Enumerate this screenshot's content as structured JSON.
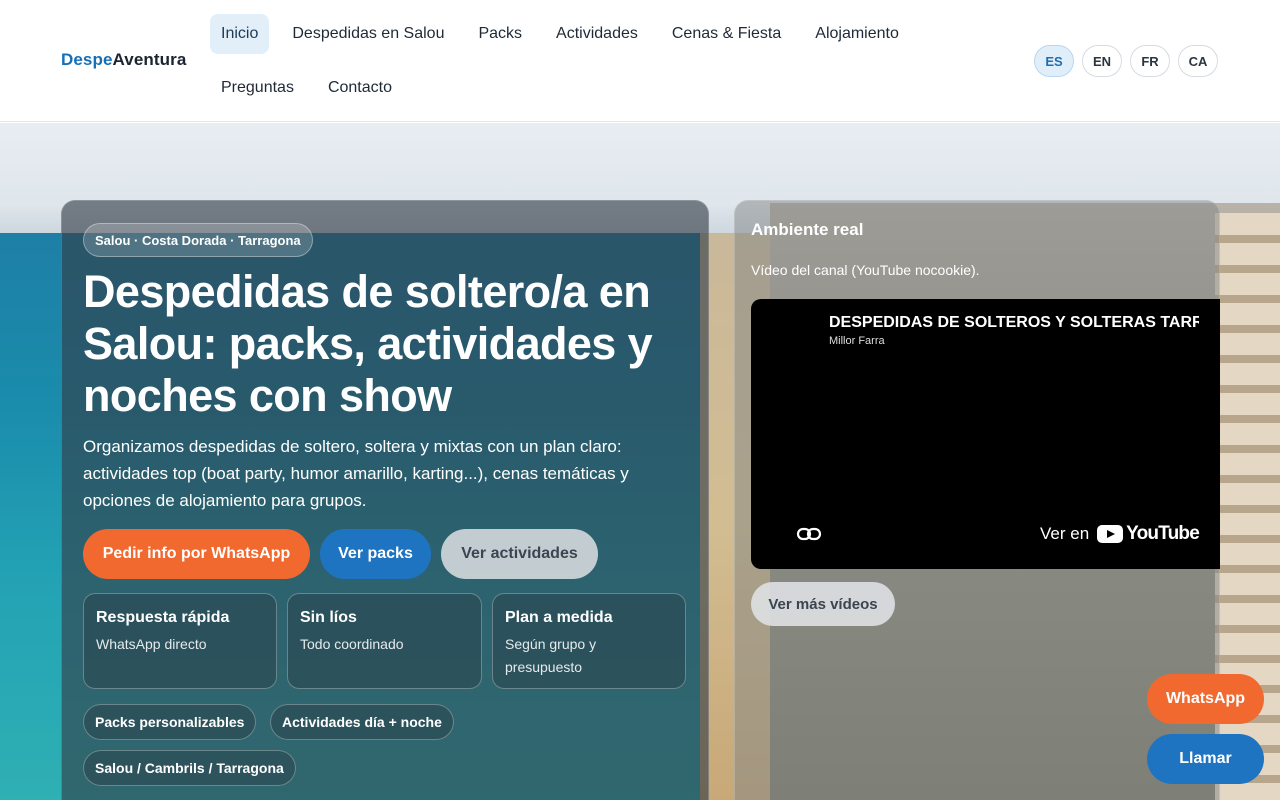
{
  "brand": {
    "part1": "Despe",
    "part2": "Aventura",
    "color_primary": "#1570b8"
  },
  "nav": {
    "row1": [
      "Inicio",
      "Despedidas en Salou",
      "Packs",
      "Actividades",
      "Cenas & Fiesta",
      "Alojamiento"
    ],
    "row2": [
      "Preguntas",
      "Contacto"
    ],
    "active": "Inicio"
  },
  "languages": [
    "ES",
    "EN",
    "FR",
    "CA"
  ],
  "active_language": "ES",
  "hero": {
    "location": "Salou · Costa Dorada · Tarragona",
    "title": "Despedidas de soltero/a en Salou: packs, actividades y noches con show",
    "description": "Organizamos despedidas de soltero, soltera y mixtas con un plan claro: actividades top (boat party, humor amarillo, karting...), cenas temáticas y opciones de alojamiento para grupos.",
    "buttons": {
      "whatsapp": "Pedir info por WhatsApp",
      "packs": "Ver packs",
      "activities": "Ver actividades"
    },
    "features": [
      {
        "title": "Respuesta rápida",
        "subtitle": "WhatsApp directo"
      },
      {
        "title": "Sin líos",
        "subtitle": "Todo coordinado"
      },
      {
        "title": "Plan a medida",
        "subtitle": "Según grupo y presupuesto"
      }
    ],
    "tags": [
      "Packs personalizables",
      "Actividades día + noche",
      "Salou / Cambrils / Tarragona"
    ]
  },
  "video_panel": {
    "title": "Ambiente real",
    "subtitle": "Vídeo del canal (YouTube nocookie).",
    "video_title": "DESPEDIDAS DE SOLTEROS Y SOLTERAS TARRAGONA",
    "channel": "Millor Farra",
    "watch_on": "Ver en",
    "youtube": "YouTube",
    "more_button": "Ver más vídeos"
  },
  "floating": {
    "whatsapp": "WhatsApp",
    "call": "Llamar"
  },
  "colors": {
    "orange": "#f2692f",
    "blue": "#1f74c2"
  }
}
